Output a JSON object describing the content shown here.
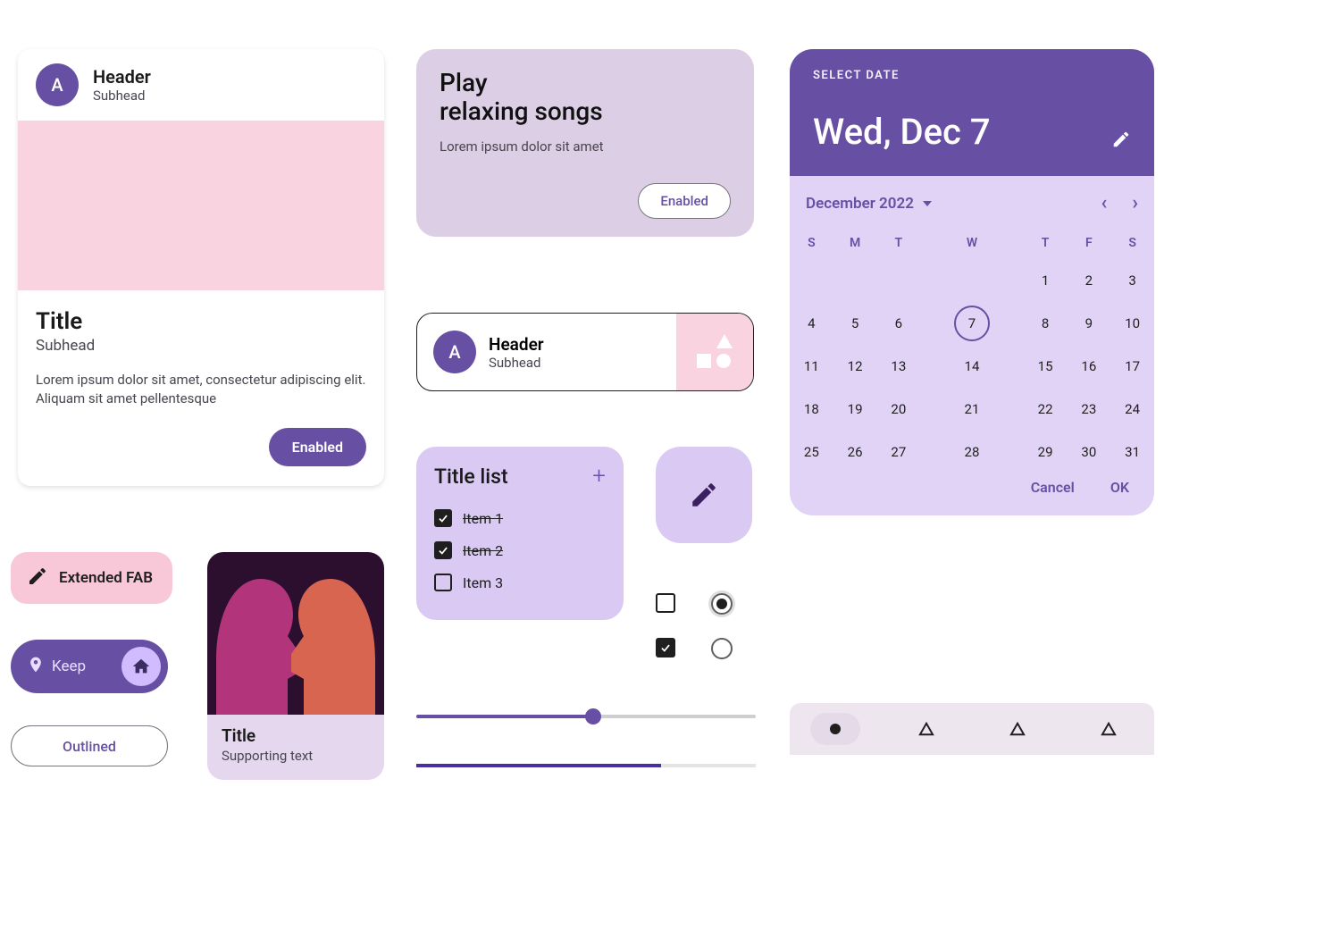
{
  "card1": {
    "avatar_letter": "A",
    "header": "Header",
    "subhead": "Subhead",
    "title": "Title",
    "title_subhead": "Subhead",
    "paragraph": "Lorem ipsum dolor sit amet, consectetur adipiscing elit. Aliquam sit amet pellentesque",
    "button": "Enabled"
  },
  "ext_fab_label": "Extended FAB",
  "keep_label": "Keep",
  "outlined_label": "Outlined",
  "media_card": {
    "title": "Title",
    "supporting": "Supporting text"
  },
  "play_card": {
    "line1": "Play",
    "line2": "relaxing songs",
    "paragraph": "Lorem ipsum dolor sit amet",
    "button": "Enabled"
  },
  "header_card": {
    "avatar_letter": "A",
    "header": "Header",
    "subhead": "Subhead"
  },
  "list_card": {
    "title": "Title list",
    "items": [
      {
        "label": "Item 1",
        "done": true
      },
      {
        "label": "Item 2",
        "done": true
      },
      {
        "label": "Item 3",
        "done": false
      }
    ]
  },
  "controls": {
    "checkbox_top": false,
    "checkbox_bottom": true,
    "radio_top": true,
    "radio_bottom": false
  },
  "slider": {
    "percent": 52
  },
  "progress": {
    "percent": 72
  },
  "date_picker": {
    "overline": "SELECT DATE",
    "selected_display": "Wed, Dec 7",
    "month_label": "December 2022",
    "weekdays": [
      "S",
      "M",
      "T",
      "W",
      "T",
      "F",
      "S"
    ],
    "weeks": [
      [
        "",
        "",
        "",
        "",
        "1",
        "2",
        "3"
      ],
      [
        "4",
        "5",
        "6",
        "7",
        "8",
        "9",
        "10"
      ],
      [
        "11",
        "12",
        "13",
        "14",
        "15",
        "16",
        "17"
      ],
      [
        "18",
        "19",
        "20",
        "21",
        "22",
        "23",
        "24"
      ],
      [
        "25",
        "26",
        "27",
        "28",
        "29",
        "30",
        "31"
      ]
    ],
    "selected_day": "7",
    "cancel": "Cancel",
    "ok": "OK"
  },
  "navbar": {
    "active_index": 0
  }
}
